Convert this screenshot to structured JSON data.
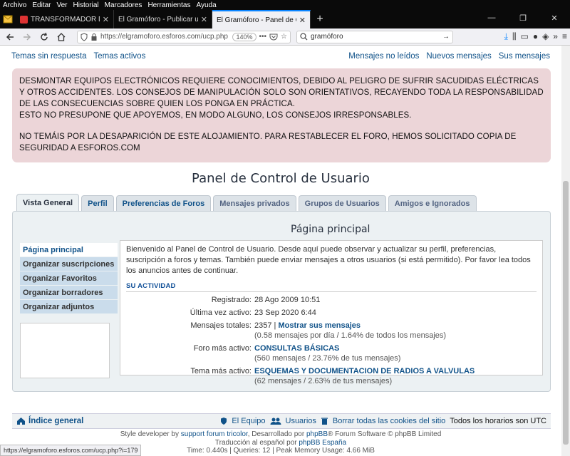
{
  "menubar": {
    "items": [
      "Archivo",
      "Editar",
      "Ver",
      "Historial",
      "Marcadores",
      "Herramientas",
      "Ayuda"
    ]
  },
  "browser": {
    "tabs": [
      {
        "label": "TRANSFORMADOR DE SALIDA DE A"
      },
      {
        "label": "El Gramóforo - Publicar una respue"
      },
      {
        "label": "El Gramóforo - Panel de Control de"
      }
    ],
    "url": "https://elgramoforo.esforos.com/ucp.php",
    "zoom": "140%",
    "search": "gramóforo",
    "status_url": "https://elgramoforo.esforos.com/ucp.php?i=179"
  },
  "quicklinks": {
    "left": [
      "Temas sin respuesta",
      "Temas activos"
    ],
    "right": [
      "Mensajes no leídos",
      "Nuevos mensajes",
      "Sus mensajes"
    ]
  },
  "notice": {
    "para1": "DESMONTAR EQUIPOS ELECTRÓNICOS REQUIERE CONOCIMIENTOS, DEBIDO AL PELIGRO DE SUFRIR SACUDIDAS ELÉCTRICAS Y OTROS ACCIDENTES. LOS CONSEJOS DE MANIPULACIÓN SOLO SON ORIENTATIVOS, RECAYENDO TODA LA RESPONSABILIDAD DE LAS CONSECUENCIAS SOBRE QUIEN LOS PONGA EN PRÁCTICA.",
    "para2": "ESTO NO PRESUPONE QUE APOYEMOS, EN MODO ALGUNO, LOS CONSEJOS IRRESPONSABLES.",
    "para3": "NO TEMÁIS POR LA DESAPARICIÓN DE ESTE ALOJAMIENTO. PARA RESTABLECER EL FORO, HEMOS SOLICITADO COPIA DE SEGURIDAD A ESFOROS.COM"
  },
  "ucp": {
    "title": "Panel de Control de Usuario",
    "tabs": [
      "Vista General",
      "Perfil",
      "Preferencias de Foros",
      "Mensajes privados",
      "Grupos de Usuarios",
      "Amigos e Ignorados"
    ],
    "side_menu": [
      "Página principal",
      "Organizar suscripciones",
      "Organizar Favoritos",
      "Organizar borradores",
      "Organizar adjuntos"
    ],
    "content_title": "Página principal",
    "intro": "Bienvenido al Panel de Control de Usuario. Desde aquí puede observar y actualizar su perfil, preferencias, suscripción a foros y temas. También puede enviar mensajes a otros usuarios (si está permitido). Por favor lea todos los anuncios antes de continuar.",
    "activity_head": "SU ACTIVIDAD",
    "stats": {
      "registered_label": "Registrado:",
      "registered": "28 Ago 2009 10:51",
      "last_active_label": "Última vez activo:",
      "last_active": "23 Sep 2020 6:44",
      "posts_label": "Mensajes totales:",
      "posts_count": "2357",
      "posts_sep": " | ",
      "posts_link": "Mostrar sus mensajes",
      "posts_sub": "(0.58 mensajes por día / 1.64% de todos los mensajes)",
      "forum_label": "Foro más activo:",
      "forum": "CONSULTAS BÁSICAS",
      "forum_sub": "(560 mensajes / 23.76% de tus mensajes)",
      "topic_label": "Tema más activo:",
      "topic": "ESQUEMAS Y DOCUMENTACION DE RADIOS A VALVULAS",
      "topic_sub": "(62 mensajes / 2.63% de tus mensajes)"
    }
  },
  "footer": {
    "home": "Índice general",
    "team": "El Equipo",
    "users": "Usuarios",
    "cookies": "Borrar todas las cookies del sitio",
    "timezone": "Todos los horarios son UTC",
    "credit1_a": "Style developer by ",
    "credit1_link": "support forum tricolor",
    "credit1_b": ", Desarrollado por ",
    "credit1_link2": "phpBB",
    "credit1_c": "® Forum Software © phpBB Limited",
    "credit2_a": "Traducción al español por ",
    "credit2_link": "phpBB España",
    "credit3": "Time: 0.440s | Queries: 12 | Peak Memory Usage: 4.66 MiB"
  }
}
